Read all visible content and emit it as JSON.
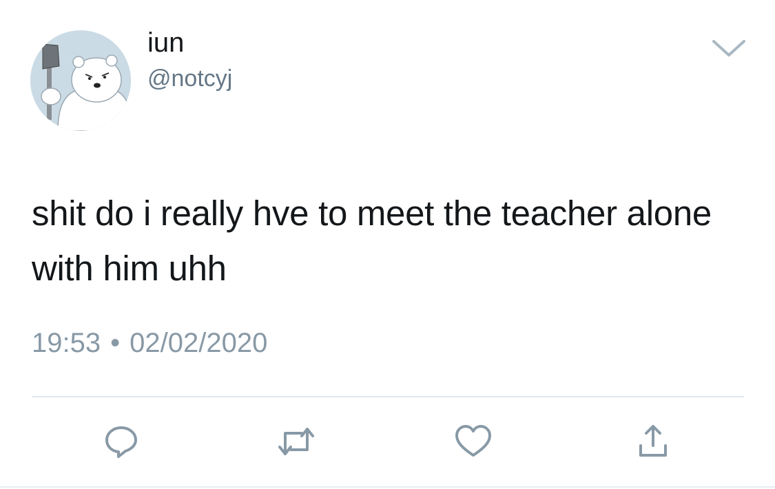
{
  "user": {
    "display_name": "iun",
    "handle": "@notcyj",
    "avatar_icon": "polar-bear-avatar"
  },
  "tweet": {
    "text": "shit do i really hve to meet the teacher alone with him uhh",
    "time": "19:53",
    "separator": "•",
    "date": "02/02/2020"
  },
  "actions": {
    "reply_icon": "reply-icon",
    "retweet_icon": "retweet-icon",
    "like_icon": "heart-icon",
    "share_icon": "share-icon"
  },
  "colors": {
    "text": "#14171a",
    "secondary": "#657786",
    "muted": "#8899a6",
    "icon": "#8899a6",
    "divider": "#e1e8ed"
  }
}
